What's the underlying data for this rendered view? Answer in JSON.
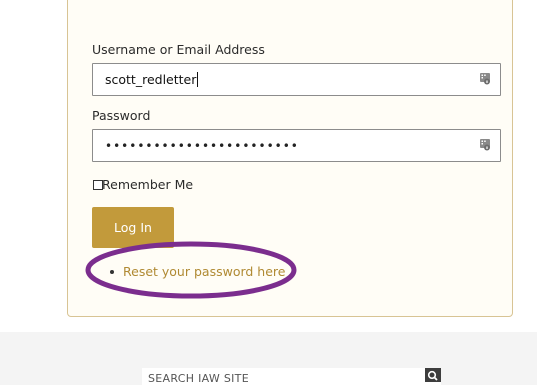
{
  "login": {
    "username_label": "Username or Email Address",
    "username_value": "scott_redletter",
    "password_label": "Password",
    "password_value": "••••••••••••••••••••••••",
    "remember_label": "Remember Me",
    "remember_checked": false,
    "login_button": "Log In",
    "reset_link": "Reset your password here"
  },
  "footer": {
    "search_placeholder": "SEARCH IAW SITE"
  },
  "colors": {
    "accent_gold": "#c29a3b",
    "link_gold": "#b08a33",
    "annotation_purple": "#7b2d8e"
  },
  "icons": {
    "password_manager": "password-manager-icon",
    "search": "search-icon"
  }
}
